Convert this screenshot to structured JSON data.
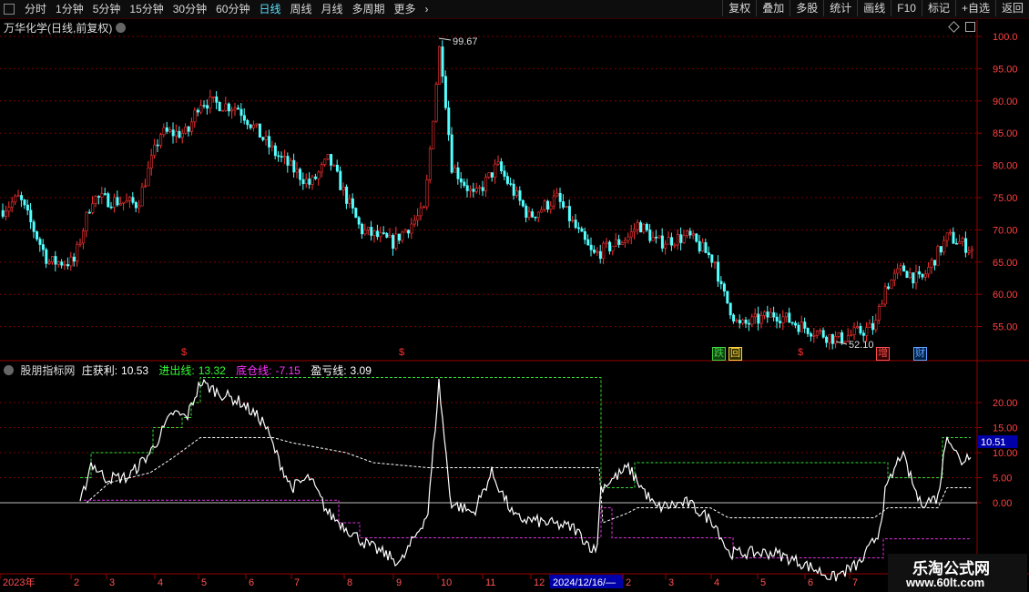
{
  "toolbar": {
    "periods": [
      "分时",
      "1分钟",
      "5分钟",
      "15分钟",
      "30分钟",
      "60分钟",
      "日线",
      "周线",
      "月线",
      "多周期",
      "更多"
    ],
    "active_period": "日线",
    "right_buttons": [
      "复权",
      "叠加",
      "多股",
      "统计",
      "画线",
      "F10",
      "标记",
      "+自选",
      "返回"
    ]
  },
  "main_chart": {
    "title": "万华化学(日线,前复权)",
    "y_ticks": [
      "100.0",
      "95.00",
      "90.00",
      "85.00",
      "80.00",
      "75.00",
      "70.00",
      "65.00",
      "60.00",
      "55.00"
    ],
    "max_label": "99.67",
    "min_label": "52.10"
  },
  "events": [
    {
      "text": "$",
      "color": "#ff3030"
    },
    {
      "text": "$",
      "color": "#ff3030"
    },
    {
      "text": "跌",
      "color": "#40d040",
      "bg": "#114411"
    },
    {
      "text": "回",
      "color": "#ffd040",
      "bg": "#333300"
    },
    {
      "text": "$",
      "color": "#ff3030"
    },
    {
      "text": "增",
      "color": "#ff5050",
      "bg": "#330000"
    },
    {
      "text": "财",
      "color": "#60a0ff",
      "bg": "#002244"
    }
  ],
  "indicator": {
    "name": "股朋指标网",
    "items": [
      {
        "label": "庄获利:",
        "value": "10.53",
        "color": "#ffffff"
      },
      {
        "label": "进出线:",
        "value": "13.32",
        "color": "#33ff33"
      },
      {
        "label": "底仓线:",
        "value": "-7.15",
        "color": "#ff33ff"
      },
      {
        "label": "盈亏线:",
        "value": "3.09",
        "color": "#ffffff"
      }
    ],
    "y_ticks": [
      "20.00",
      "15.00",
      "10.00",
      "5.00",
      "0.00"
    ],
    "current_value": "10.51"
  },
  "x_axis": {
    "labels": [
      "2023年",
      "2",
      "3",
      "4",
      "5",
      "6",
      "7",
      "8",
      "9",
      "10",
      "11",
      "12",
      "2024/12/16/—",
      "2",
      "3",
      "4",
      "5",
      "6",
      "7"
    ]
  },
  "watermark": {
    "line1": "乐淘公式网",
    "line2": "www.60lt.com"
  },
  "colors": {
    "up": "#ff3232",
    "down": "#54ffff",
    "grid": "#7a0000"
  }
}
